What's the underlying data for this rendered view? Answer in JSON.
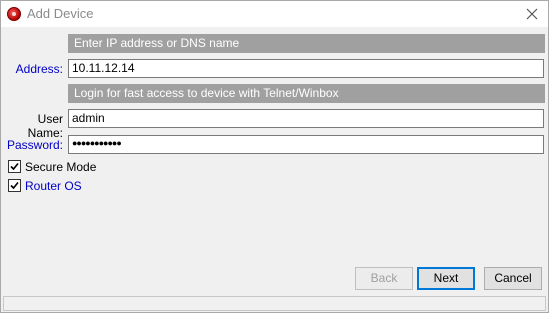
{
  "window": {
    "title": "Add Device"
  },
  "address_section": {
    "header": "Enter IP address or DNS name",
    "label": "Address:",
    "value": "10.11.12.14"
  },
  "login_section": {
    "header": "Login for fast access to device with Telnet/Winbox",
    "username_label": "User Name:",
    "username_value": "admin",
    "password_label": "Password:",
    "password_mask": "●●●●●●●●●●●"
  },
  "options": {
    "secure_mode": {
      "label": "Secure Mode",
      "checked": true
    },
    "router_os": {
      "label": "Router OS",
      "checked": true
    }
  },
  "buttons": {
    "back": "Back",
    "next": "Next",
    "cancel": "Cancel"
  },
  "colors": {
    "header_bg": "#a0a0a0",
    "label_blue": "#0000c8",
    "default_button_border": "#0078d7"
  },
  "icons": [
    "app-icon",
    "close-icon",
    "check-icon"
  ]
}
